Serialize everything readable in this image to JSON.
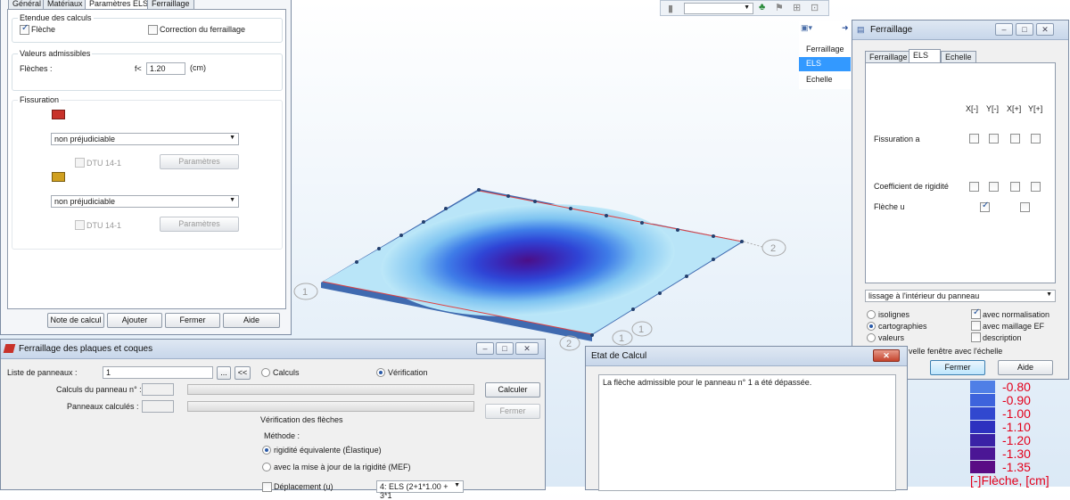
{
  "toolbar": {
    "dropdown_value": ""
  },
  "params_window": {
    "tabs": [
      "Général",
      "Matériaux",
      "Paramètres ELS",
      "Ferraillage"
    ],
    "etendue": {
      "title": "Etendue des calculs",
      "fleche": "Flèche",
      "correction": "Correction du ferraillage"
    },
    "valeurs": {
      "title": "Valeurs admissibles",
      "fleches_label": "Flèches :",
      "f_label": "f<",
      "f_value": "1.20",
      "unit": "(cm)"
    },
    "fissuration": {
      "title": "Fissuration",
      "select1": "non préjudiciable",
      "dtu1": "DTU 14-1",
      "params1": "Paramètres",
      "select2": "non préjudiciable",
      "dtu2": "DTU 14-1",
      "params2": "Paramètres"
    },
    "buttons": {
      "note": "Note de calcul",
      "ajouter": "Ajouter",
      "fermer": "Fermer",
      "aide": "Aide"
    }
  },
  "side_menu": {
    "items": [
      "Ferraillage",
      "ELS",
      "Echelle"
    ]
  },
  "ferr_window": {
    "title": "Ferraillage",
    "tabs": [
      "Ferraillage",
      "ELS",
      "Echelle"
    ],
    "cols": [
      "X[-]",
      "Y[-]",
      "X[+]",
      "Y[+]"
    ],
    "rows": {
      "fissuration": "Fissuration a",
      "rigidite": "Coefficient de rigidité",
      "fleche": "Flèche u"
    },
    "select": "lissage à l'intérieur du panneau",
    "radios": [
      "isolignes",
      "cartographies",
      "valeurs"
    ],
    "checks": [
      "avec normalisation",
      "avec maillage EF",
      "description"
    ],
    "new_window_text": "velle fenêtre avec l'échelle",
    "buttons": {
      "fermer": "Fermer",
      "aide": "Aide"
    }
  },
  "plates_window": {
    "title": "Ferraillage des plaques et coques",
    "liste_label": "Liste de panneaux :",
    "liste_value": "1",
    "btn_more": "...",
    "btn_back": "<<",
    "radio_calculs": "Calculs",
    "radio_verif": "Vérification",
    "calculs_panneau": "Calculs du panneau n° :",
    "panneaux_calcules": "Panneaux calculés :",
    "btn_calculer": "Calculer",
    "btn_fermer": "Fermer",
    "verif_title": "Vérification des flèches",
    "methode": "Méthode :",
    "opt1": "rigidité équivalente (Élastique)",
    "opt2": "avec la mise à jour de la rigidité (MEF)",
    "deplacement_label": "Déplacement (u)",
    "deplacement_value": "4: ELS (2+1*1.00 + 3*1"
  },
  "etat_window": {
    "title": "Etat de Calcul",
    "message": "La flèche admissible pour le panneau n° 1 a été dépassée."
  },
  "viewport": {
    "labels": [
      "1",
      "2",
      "2",
      "1",
      "1"
    ]
  },
  "legend": {
    "values": [
      "-0.80",
      "-0.90",
      "-1.00",
      "-1.10",
      "-1.20",
      "-1.30",
      "-1.35"
    ],
    "colors": [
      "#4f7fe6",
      "#3d63dc",
      "#3148cf",
      "#2d31bf",
      "#3a22a6",
      "#4b1695",
      "#5a0c85"
    ],
    "caption": "[-]Flèche, [cm]",
    "text_color": "#e3001b"
  }
}
